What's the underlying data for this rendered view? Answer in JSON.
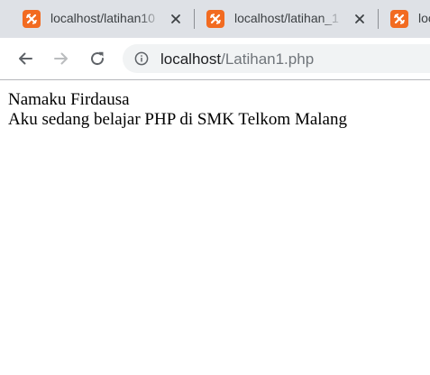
{
  "tabs": [
    {
      "title": "localhost/latihan10"
    },
    {
      "title": "localhost/latihan_1"
    },
    {
      "title": "localhost/latihan"
    }
  ],
  "address_bar": {
    "host": "localhost",
    "path": "/Latihan1.php"
  },
  "page": {
    "lines": [
      "Namaku Firdausa",
      "Aku sedang belajar PHP di SMK Telkom Malang"
    ]
  },
  "colors": {
    "tab_strip": "#dee1e6",
    "favicon": "#f26b21",
    "omnibox": "#f1f3f4"
  },
  "icons": {
    "favicon": "xampp-icon",
    "close": "close-icon",
    "back": "back-arrow-icon",
    "forward": "forward-arrow-icon",
    "reload": "reload-icon",
    "info": "info-icon"
  }
}
